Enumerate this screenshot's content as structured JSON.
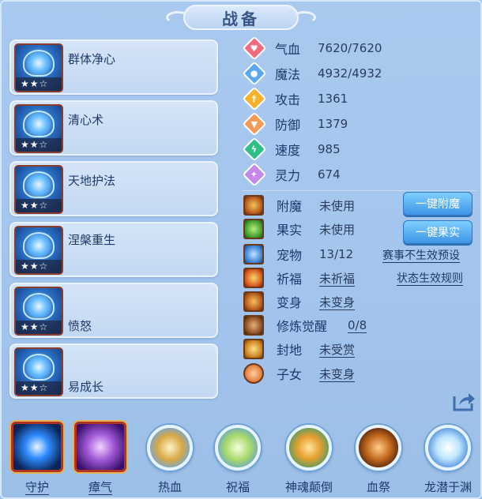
{
  "title": "战备",
  "skills": [
    {
      "name": "群体净心",
      "stars": "★★☆"
    },
    {
      "name": "清心术",
      "stars": "★★☆"
    },
    {
      "name": "天地护法",
      "stars": "★★☆"
    },
    {
      "name": "涅槃重生",
      "stars": "★★☆"
    },
    {
      "name": "愤怒",
      "stars": "★★☆"
    },
    {
      "name": "易成长",
      "stars": "★★☆"
    }
  ],
  "stats": [
    {
      "label": "气血",
      "value": "7620/7620",
      "icon": "heart-icon",
      "color": "#f06b7c"
    },
    {
      "label": "魔法",
      "value": "4932/4932",
      "icon": "mana-icon",
      "color": "#5aa8f0"
    },
    {
      "label": "攻击",
      "value": "1361",
      "icon": "sword-icon",
      "color": "#f5b22c"
    },
    {
      "label": "防御",
      "value": "1379",
      "icon": "shield-icon",
      "color": "#f29a58"
    },
    {
      "label": "速度",
      "value": "985",
      "icon": "lightning-icon",
      "color": "#2fc08a"
    },
    {
      "label": "灵力",
      "value": "674",
      "icon": "spirit-icon",
      "color": "#c489ea"
    }
  ],
  "items": [
    {
      "label": "附魔",
      "value": "未使用",
      "underline": false
    },
    {
      "label": "果实",
      "value": "未使用",
      "underline": false
    },
    {
      "label": "宠物",
      "value": "13/12",
      "underline": false
    },
    {
      "label": "祈福",
      "value": "未祈福",
      "underline": true
    },
    {
      "label": "变身",
      "value": "未变身",
      "underline": true
    },
    {
      "label": "修炼觉醒",
      "value": "0/8",
      "underline": true
    },
    {
      "label": "封地",
      "value": "未受赏",
      "underline": true
    },
    {
      "label": "子女",
      "value": "未变身",
      "underline": true
    }
  ],
  "buttons": {
    "enchant": "一键附魔",
    "fruit": "一键果实"
  },
  "links": {
    "preset": "赛事不生效预设",
    "rules": "状态生效规则"
  },
  "bottom": [
    {
      "label": "守护",
      "style": "square",
      "color": "#2f8cff"
    },
    {
      "label": "瘴气",
      "style": "square",
      "color": "#a35ad8"
    },
    {
      "label": "热血",
      "style": "round",
      "color": "#d8a845"
    },
    {
      "label": "祝福",
      "style": "round",
      "color": "#a8d86a"
    },
    {
      "label": "神魂颠倒",
      "style": "round",
      "color": "#e8a030"
    },
    {
      "label": "血祭",
      "style": "round",
      "color": "#c0641c"
    },
    {
      "label": "龙潜于渊",
      "style": "round",
      "color": "#bfe6ff"
    }
  ]
}
